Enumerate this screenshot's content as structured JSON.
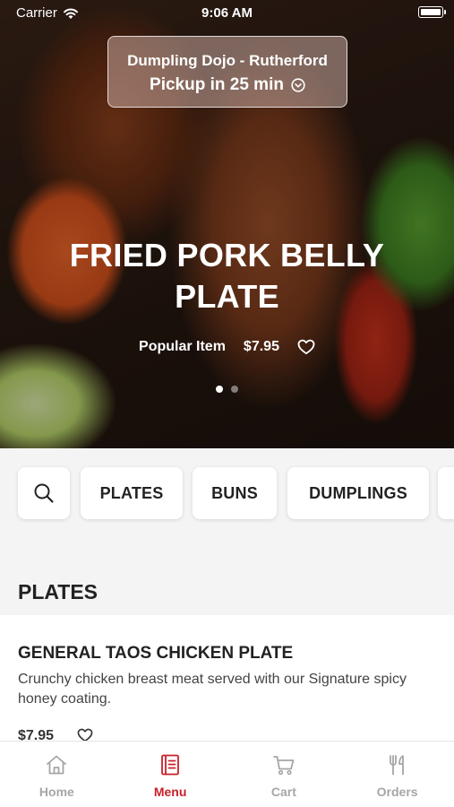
{
  "status_bar": {
    "carrier": "Carrier",
    "time": "9:06 AM"
  },
  "location": {
    "name": "Dumpling Dojo - Rutherford",
    "pickup": "Pickup in 25 min"
  },
  "featured": {
    "title": "FRIED PORK BELLY PLATE",
    "tag": "Popular Item",
    "price": "$7.95",
    "page_count": 2,
    "active_page": 1
  },
  "categories": {
    "items": [
      "PLATES",
      "BUNS",
      "DUMPLINGS"
    ]
  },
  "section": {
    "title": "PLATES",
    "items": [
      {
        "name": "GENERAL TAOS CHICKEN PLATE",
        "description": "Crunchy chicken breast meat served with our Signature spicy honey coating.",
        "price": "$7.95"
      }
    ]
  },
  "tabs": [
    {
      "label": "Home",
      "icon": "home-icon"
    },
    {
      "label": "Menu",
      "icon": "menu-icon",
      "active": true
    },
    {
      "label": "Cart",
      "icon": "cart-icon"
    },
    {
      "label": "Orders",
      "icon": "orders-icon"
    }
  ],
  "colors": {
    "accent": "#c8202a",
    "tab_inactive": "#a6a6a6",
    "background": "#f4f4f4"
  }
}
